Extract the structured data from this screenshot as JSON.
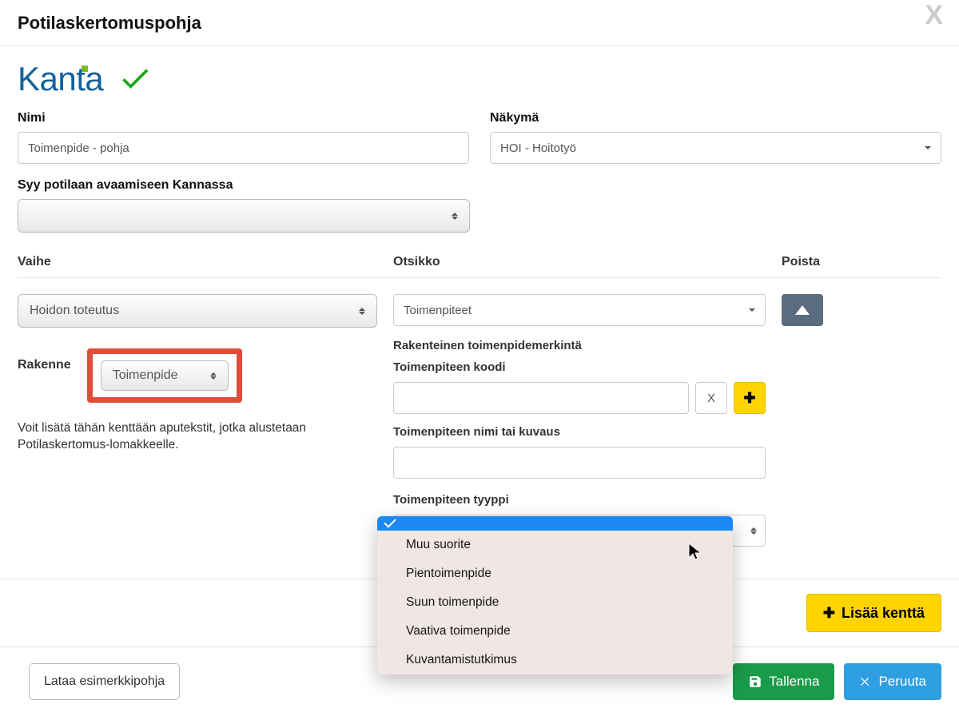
{
  "header": {
    "title": "Potilaskertomuspohja"
  },
  "brand": {
    "name": "Kanta"
  },
  "fields": {
    "nimi_label": "Nimi",
    "nimi_value": "Toimenpide - pohja",
    "nakyma_label": "Näkymä",
    "nakyma_value": "HOI - Hoitotyö",
    "syy_label": "Syy potilaan avaamiseen Kannassa",
    "syy_value": ""
  },
  "columns": {
    "vaihe": "Vaihe",
    "otsikko": "Otsikko",
    "poista": "Poista"
  },
  "vaihe": {
    "value": "Hoidon toteutus"
  },
  "rakenne": {
    "label": "Rakenne",
    "value": "Toimenpide",
    "hint": "Voit lisätä tähän kenttään aputekstit, jotka alustetaan Potilaskertomus-lomakkeelle."
  },
  "otsikko": {
    "value": "Toimenpiteet",
    "subheading": "Rakenteinen toimenpidemerkintä",
    "koodi_label": "Toimenpiteen koodi",
    "koodi_value": "",
    "clear_label": "X",
    "nimi_label": "Toimenpiteen nimi tai kuvaus",
    "nimi_value": "",
    "tyyppi_label": "Toimenpiteen tyyppi",
    "tyyppi_options": [
      "",
      "Muu suorite",
      "Pientoimenpide",
      "Suun toimenpide",
      "Vaativa toimenpide",
      "Kuvantamistutkimus"
    ],
    "tyyppi_selected_index": 0
  },
  "buttons": {
    "add_field": "Lisää kenttä",
    "load_example": "Lataa esimerkkipohja",
    "save": "Tallenna",
    "cancel": "Peruuta"
  }
}
